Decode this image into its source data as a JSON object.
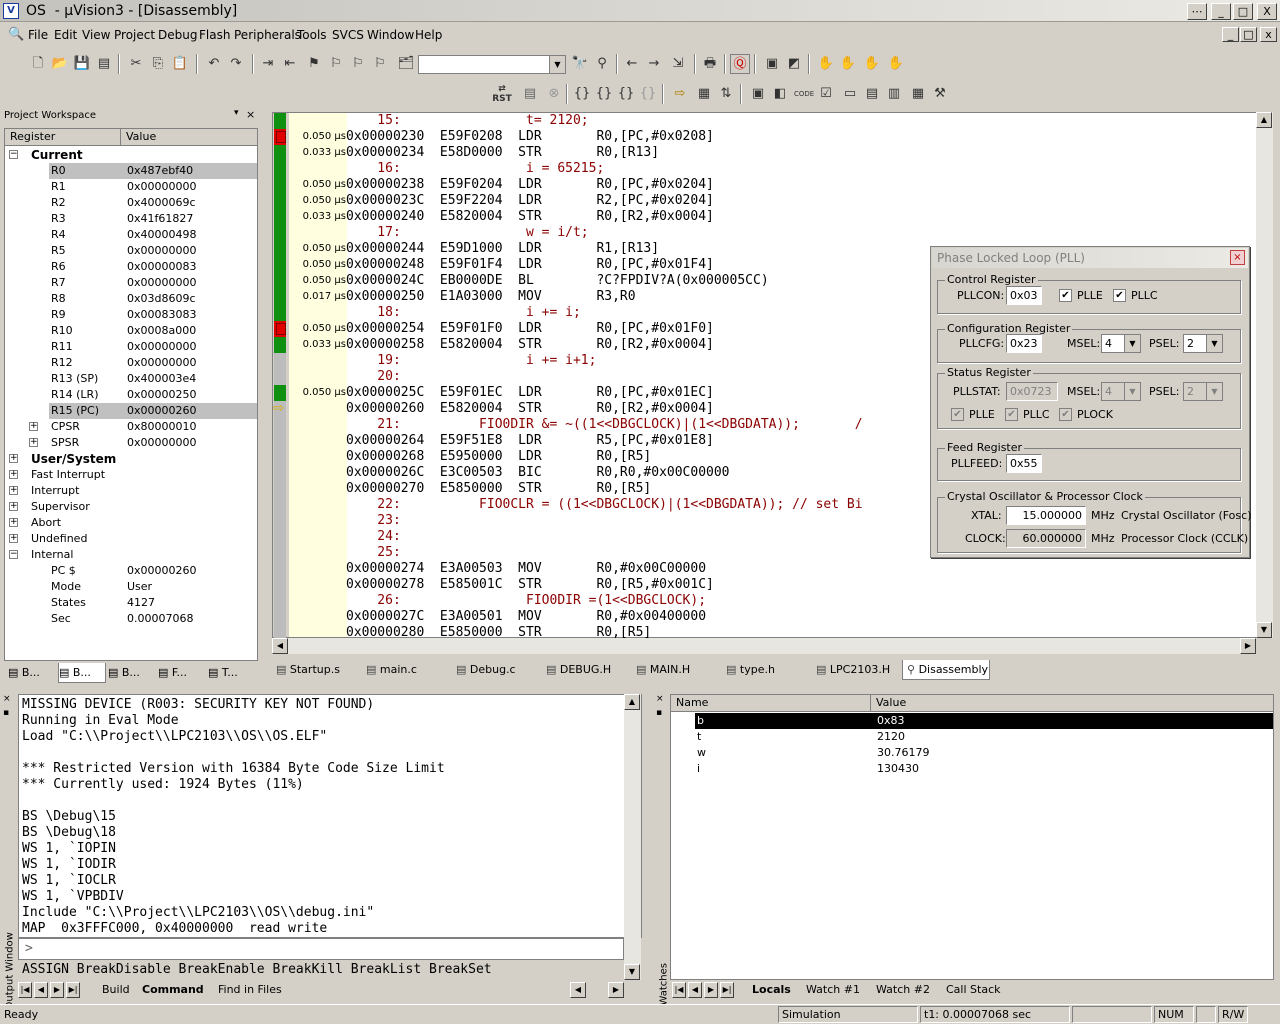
{
  "window": {
    "title": "OS  - µVision3 - [Disassembly]",
    "minimize": "_",
    "restore": "□",
    "close": "X"
  },
  "menu": [
    "File",
    "Edit",
    "View",
    "Project",
    "Debug",
    "Flash",
    "Peripherals",
    "Tools",
    "SVCS",
    "Window",
    "Help"
  ],
  "workspace": {
    "title": "Project Workspace",
    "columns": [
      "Register",
      "Value"
    ],
    "groups": {
      "current": "Current",
      "user": "User/System",
      "fast": "Fast Interrupt",
      "irq": "Interrupt",
      "svc": "Supervisor",
      "abt": "Abort",
      "und": "Undefined",
      "internal": "Internal"
    },
    "registers": [
      {
        "name": "R0",
        "value": "0x487ebf40"
      },
      {
        "name": "R1",
        "value": "0x00000000"
      },
      {
        "name": "R2",
        "value": "0x4000069c"
      },
      {
        "name": "R3",
        "value": "0x41f61827"
      },
      {
        "name": "R4",
        "value": "0x40000498"
      },
      {
        "name": "R5",
        "value": "0x00000000"
      },
      {
        "name": "R6",
        "value": "0x00000083"
      },
      {
        "name": "R7",
        "value": "0x00000000"
      },
      {
        "name": "R8",
        "value": "0x03d8609c"
      },
      {
        "name": "R9",
        "value": "0x00083083"
      },
      {
        "name": "R10",
        "value": "0x0008a000"
      },
      {
        "name": "R11",
        "value": "0x00000000"
      },
      {
        "name": "R12",
        "value": "0x00000000"
      },
      {
        "name": "R13 (SP)",
        "value": "0x400003e4"
      },
      {
        "name": "R14 (LR)",
        "value": "0x00000250"
      },
      {
        "name": "R15 (PC)",
        "value": "0x00000260"
      },
      {
        "name": "CPSR",
        "value": "0x80000010"
      },
      {
        "name": "SPSR",
        "value": "0x00000000"
      }
    ],
    "internal": [
      {
        "name": "PC  $",
        "value": "0x00000260"
      },
      {
        "name": "Mode",
        "value": "User"
      },
      {
        "name": "States",
        "value": "4127"
      },
      {
        "name": "Sec",
        "value": "0.00007068"
      }
    ],
    "tabs": [
      "B...",
      "B...",
      "B...",
      "F...",
      "T..."
    ]
  },
  "disasm": {
    "lines": [
      {
        "t": "",
        "text": "    15:                t= 2120;",
        "src": true,
        "bar": "green"
      },
      {
        "t": "0.050 µs",
        "text": "0x00000230  E59F0208  LDR       R0,[PC,#0x0208]",
        "src": false,
        "bar": "red"
      },
      {
        "t": "0.033 µs",
        "text": "0x00000234  E58D0000  STR       R0,[R13]",
        "src": false,
        "bar": "green"
      },
      {
        "t": "",
        "text": "    16:                i = 65215;",
        "src": true,
        "bar": "green"
      },
      {
        "t": "0.050 µs",
        "text": "0x00000238  E59F0204  LDR       R0,[PC,#0x0204]",
        "src": false,
        "bar": "green"
      },
      {
        "t": "0.050 µs",
        "text": "0x0000023C  E59F2204  LDR       R2,[PC,#0x0204]",
        "src": false,
        "bar": "green"
      },
      {
        "t": "0.033 µs",
        "text": "0x00000240  E5820004  STR       R0,[R2,#0x0004]",
        "src": false,
        "bar": "green"
      },
      {
        "t": "",
        "text": "    17:                w = i/t;",
        "src": true,
        "bar": "green"
      },
      {
        "t": "0.050 µs",
        "text": "0x00000244  E59D1000  LDR       R1,[R13]",
        "src": false,
        "bar": "green"
      },
      {
        "t": "0.050 µs",
        "text": "0x00000248  E59F01F4  LDR       R0,[PC,#0x01F4]",
        "src": false,
        "bar": "green"
      },
      {
        "t": "0.050 µs",
        "text": "0x0000024C  EB0000DE  BL        ?C?FPDIV?A(0x000005CC)",
        "src": false,
        "bar": "green"
      },
      {
        "t": "0.017 µs",
        "text": "0x00000250  E1A03000  MOV       R3,R0",
        "src": false,
        "bar": "green"
      },
      {
        "t": "",
        "text": "    18:                i += i;",
        "src": true,
        "bar": "green"
      },
      {
        "t": "0.050 µs",
        "text": "0x00000254  E59F01F0  LDR       R0,[PC,#0x01F0]",
        "src": false,
        "bar": "red"
      },
      {
        "t": "0.033 µs",
        "text": "0x00000258  E5820004  STR       R0,[R2,#0x0004]",
        "src": false,
        "bar": "green"
      },
      {
        "t": "",
        "text": "    19:                i += i+1;",
        "src": true,
        "bar": "gray"
      },
      {
        "t": "",
        "text": "    20:",
        "src": true,
        "bar": "gray"
      },
      {
        "t": "0.050 µs",
        "text": "0x0000025C  E59F01EC  LDR       R0,[PC,#0x01EC]",
        "src": false,
        "bar": "green"
      },
      {
        "t": "",
        "text": "0x00000260  E5820004  STR       R0,[R2,#0x0004]",
        "src": false,
        "bar": "arrow"
      },
      {
        "t": "",
        "text": "    21:          FIO0DIR &= ~((1<<DBGCLOCK)|(1<<DBGDATA));       /",
        "src": true,
        "bar": "gray"
      },
      {
        "t": "",
        "text": "0x00000264  E59F51E8  LDR       R5,[PC,#0x01E8]",
        "src": false,
        "bar": "gray"
      },
      {
        "t": "",
        "text": "0x00000268  E5950000  LDR       R0,[R5]",
        "src": false,
        "bar": "gray"
      },
      {
        "t": "",
        "text": "0x0000026C  E3C00503  BIC       R0,R0,#0x00C00000",
        "src": false,
        "bar": "gray"
      },
      {
        "t": "",
        "text": "0x00000270  E5850000  STR       R0,[R5]",
        "src": false,
        "bar": "gray"
      },
      {
        "t": "",
        "text": "    22:          FIO0CLR = ((1<<DBGCLOCK)|(1<<DBGDATA)); // set Bi",
        "src": true,
        "bar": "gray"
      },
      {
        "t": "",
        "text": "    23:",
        "src": true,
        "bar": "gray"
      },
      {
        "t": "",
        "text": "    24:",
        "src": true,
        "bar": "gray"
      },
      {
        "t": "",
        "text": "    25:",
        "src": true,
        "bar": "gray"
      },
      {
        "t": "",
        "text": "0x00000274  E3A00503  MOV       R0,#0x00C00000",
        "src": false,
        "bar": "gray"
      },
      {
        "t": "",
        "text": "0x00000278  E585001C  STR       R0,[R5,#0x001C]",
        "src": false,
        "bar": "gray"
      },
      {
        "t": "",
        "text": "    26:                FIO0DIR =(1<<DBGCLOCK);",
        "src": true,
        "bar": "gray"
      },
      {
        "t": "",
        "text": "0x0000027C  E3A00501  MOV       R0,#0x00400000",
        "src": false,
        "bar": "gray"
      },
      {
        "t": "",
        "text": "0x00000280  E5850000  STR       R0,[R5]",
        "src": false,
        "bar": "gray"
      }
    ]
  },
  "filetabs": [
    "Startup.s",
    "main.c",
    "Debug.c",
    "DEBUG.H",
    "MAIN.H",
    "type.h",
    "LPC2103.H",
    "Disassembly"
  ],
  "pll": {
    "title": "Phase Locked Loop (PLL)",
    "control": {
      "group": "Control Register",
      "pllcon_label": "PLLCON:",
      "pllcon": "0x03",
      "plle": "PLLE",
      "pllc": "PLLC"
    },
    "config": {
      "group": "Configuration Register",
      "pllcfg_label": "PLLCFG:",
      "pllcfg": "0x23",
      "msel_label": "MSEL:",
      "msel": "4",
      "psel_label": "PSEL:",
      "psel": "2"
    },
    "status": {
      "group": "Status Register",
      "pllstat_label": "PLLSTAT:",
      "pllstat": "0x0723",
      "msel_label": "MSEL:",
      "msel": "4",
      "psel_label": "PSEL:",
      "psel": "2",
      "plle": "PLLE",
      "pllc": "PLLC",
      "plock": "PLOCK"
    },
    "feed": {
      "group": "Feed Register",
      "pllfeed_label": "PLLFEED:",
      "pllfeed": "0x55"
    },
    "osc": {
      "group": "Crystal Oscillator & Processor Clock",
      "xtal_label": "XTAL:",
      "xtal": "15.000000",
      "xtal_unit": "MHz",
      "xtal_desc": "Crystal Oscillator (Fosc)",
      "clock_label": "CLOCK:",
      "clock": "60.000000",
      "clock_unit": "MHz",
      "clock_desc": "Processor Clock (CCLK)"
    }
  },
  "output": {
    "side_label": "Output Window",
    "lines": [
      "MISSING DEVICE (R003: SECURITY KEY NOT FOUND)",
      "Running in Eval Mode",
      "Load \"C:\\\\Project\\\\LPC2103\\\\OS\\\\OS.ELF\"",
      "",
      "*** Restricted Version with 16384 Byte Code Size Limit",
      "*** Currently used: 1924 Bytes (11%)",
      "",
      "BS \\Debug\\15",
      "BS \\Debug\\18",
      "WS 1, `IOPIN",
      "WS 1, `IODIR",
      "WS 1, `IOCLR",
      "WS 1, `VPBDIV",
      "Include \"C:\\\\Project\\\\LPC2103\\\\OS\\\\debug.ini\"",
      "MAP  0x3FFFC000, 0x40000000  read write"
    ],
    "prompt": ">",
    "hint": "ASSIGN BreakDisable BreakEnable BreakKill BreakList BreakSet",
    "tabs": [
      "Build",
      "Command",
      "Find in Files"
    ]
  },
  "watch": {
    "side_label": "Watches",
    "columns": [
      "Name",
      "Value"
    ],
    "rows": [
      {
        "name": "b",
        "value": "0x83"
      },
      {
        "name": "t",
        "value": "2120"
      },
      {
        "name": "w",
        "value": "30.76179"
      },
      {
        "name": "i",
        "value": "130430"
      }
    ],
    "tabs": [
      "Locals",
      "Watch #1",
      "Watch #2",
      "Call Stack"
    ]
  },
  "statusbar": {
    "ready": "Ready",
    "sim": "Simulation",
    "t1": "t1: 0.00007068 sec",
    "num": "NUM",
    "rw": "R/W"
  }
}
